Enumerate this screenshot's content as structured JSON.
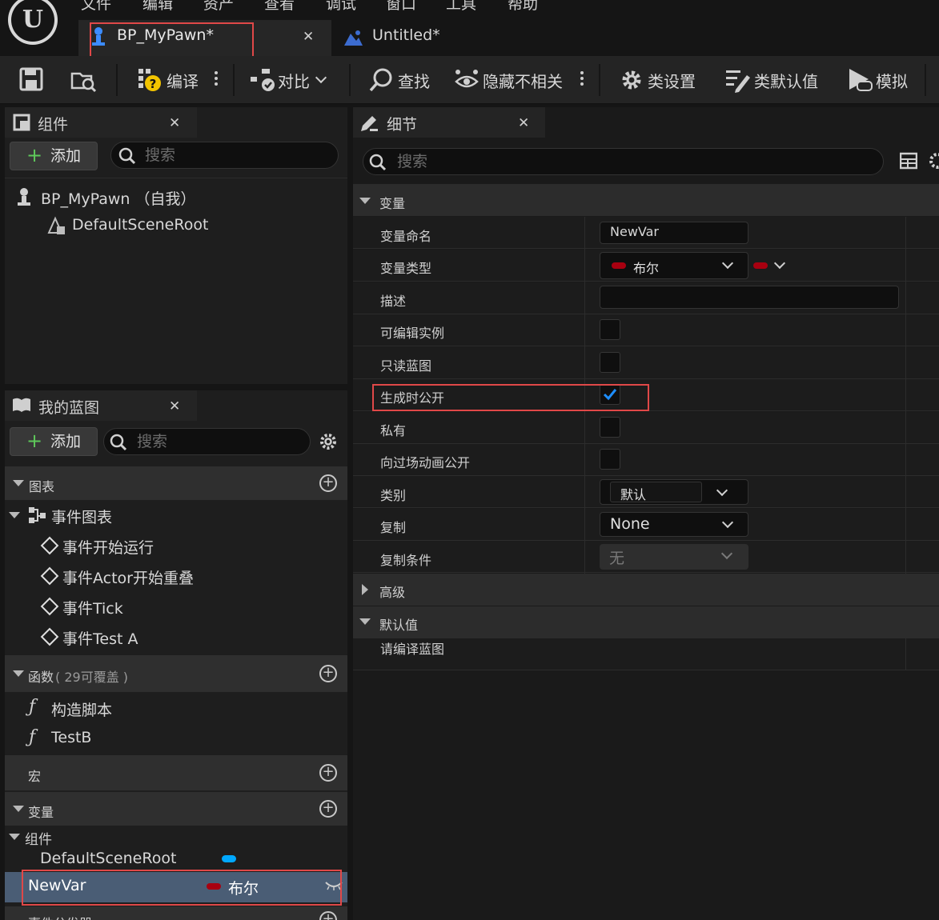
{
  "menu": [
    "文件",
    "编辑",
    "资产",
    "查看",
    "调试",
    "窗口",
    "工具",
    "帮助"
  ],
  "tabs": {
    "blueprint": "BP_MyPawn*",
    "level": "Untitled*"
  },
  "toolbar": {
    "compile": "编译",
    "diff": "对比",
    "find": "查找",
    "hide_unrelated": "隐藏不相关",
    "class_settings": "类设置",
    "class_defaults": "类默认值",
    "simulate": "模拟"
  },
  "components_panel": {
    "title": "组件",
    "add": "添加",
    "search_placeholder": "搜索",
    "root": "BP_MyPawn （自我）",
    "child": "DefaultSceneRoot"
  },
  "my_blueprint": {
    "title": "我的蓝图",
    "add": "添加",
    "search_placeholder": "搜索",
    "graphs_header": "图表",
    "event_graph": "事件图表",
    "events": [
      "事件开始运行",
      "事件Actor开始重叠",
      "事件Tick",
      "事件Test A"
    ],
    "functions_header": "函数",
    "functions_note": "( 29可覆盖 )",
    "functions": [
      "构造脚本",
      "TestB"
    ],
    "macros_header": "宏",
    "variables_header": "变量",
    "components_group": "组件",
    "component_var": "DefaultSceneRoot",
    "selected_var": "NewVar",
    "selected_var_type": "布尔",
    "dispatchers_header": "事件分发器"
  },
  "details": {
    "title": "细节",
    "search_placeholder": "搜索",
    "section_variable": "变量",
    "rows": {
      "var_name_label": "变量命名",
      "var_name_value": "NewVar",
      "var_type_label": "变量类型",
      "var_type_value": "布尔",
      "description_label": "描述",
      "instance_editable_label": "可编辑实例",
      "readonly_label": "只读蓝图",
      "expose_spawn_label": "生成时公开",
      "private_label": "私有",
      "expose_cinematics_label": "向过场动画公开",
      "category_label": "类别",
      "category_value": "默认",
      "replication_label": "复制",
      "replication_value": "None",
      "rep_condition_label": "复制条件",
      "rep_condition_value": "无"
    },
    "section_advanced": "高级",
    "section_defaults": "默认值",
    "defaults_note": "请编译蓝图"
  },
  "colors": {
    "bool_pin": "#a80010",
    "component_pin": "#00a8ff",
    "check": "#1e8eff",
    "highlight": "#e04848"
  }
}
